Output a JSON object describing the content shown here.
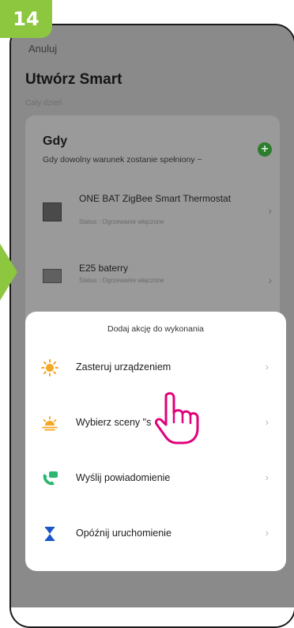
{
  "step_badge": "14",
  "header": {
    "cancel": "Anuluj",
    "title": "Utwórz Smart",
    "subtitle": "Cały dzień"
  },
  "condition": {
    "title": "Gdy",
    "description": "Gdy dowolny warunek zostanie spełniony ~",
    "add_icon": "plus-circle-icon",
    "devices": [
      {
        "name": "ONE BAT ZigBee Smart Thermostat",
        "status": "Status : Ogrzewanie włączone"
      },
      {
        "name": "E25 baterry",
        "status": "Status : Ogrzewanie włączone"
      }
    ]
  },
  "sheet": {
    "title": "Dodaj akcję do wykonania",
    "items": [
      {
        "label": "Zasteruj urządzeniem",
        "icon": "sun-icon"
      },
      {
        "label": "Wybierz sceny \"s",
        "icon": "sunset-icon"
      },
      {
        "label": "Wyślij powiadomienie",
        "icon": "phone-message-icon"
      },
      {
        "label": "Opóźnij uruchomienie",
        "icon": "hourglass-icon"
      }
    ]
  },
  "colors": {
    "accent_green": "#8dc63f",
    "pointer_magenta": "#e0007a",
    "add_green": "#2e7d2e"
  }
}
